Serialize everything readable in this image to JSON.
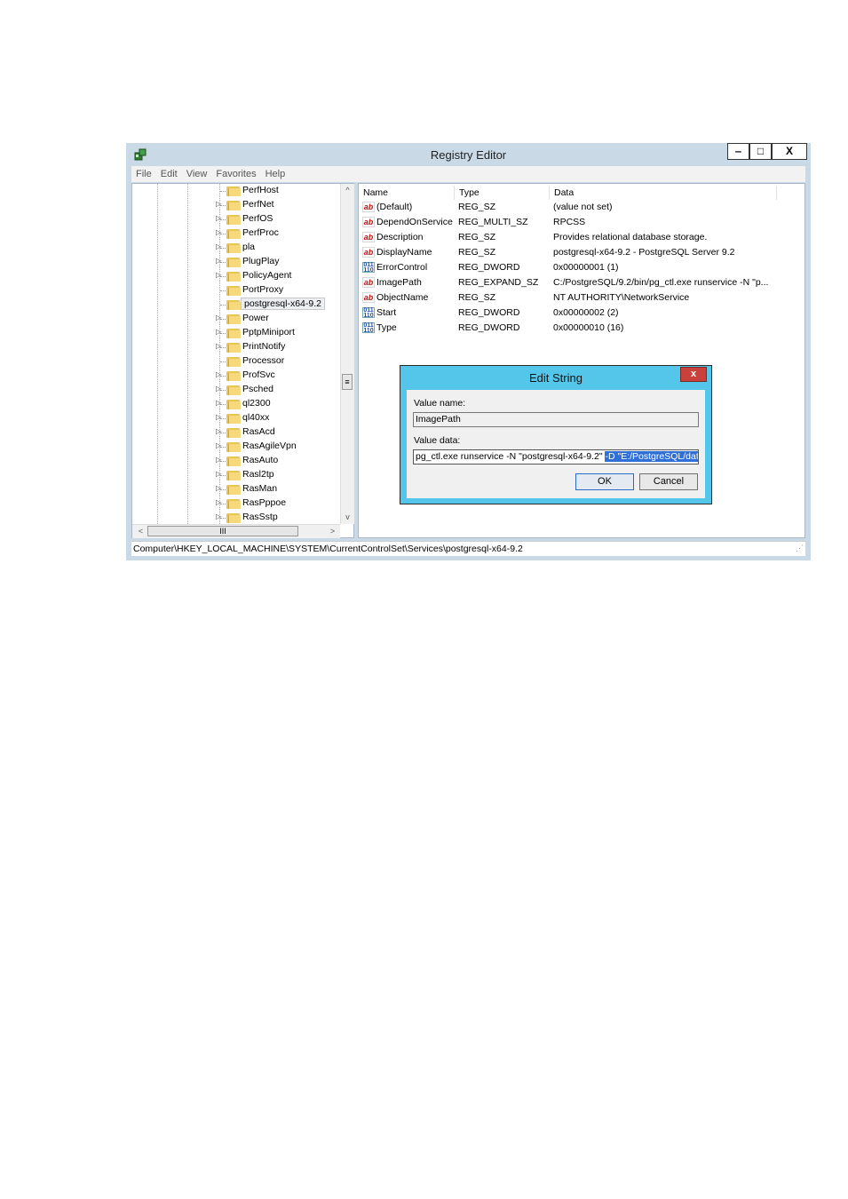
{
  "window": {
    "title": "Registry Editor",
    "controls": {
      "minimize": "‒",
      "maximize": "□",
      "close": "X"
    }
  },
  "menubar": [
    "File",
    "Edit",
    "View",
    "Favorites",
    "Help"
  ],
  "tree": {
    "items": [
      {
        "label": "PerfHost",
        "expandable": false
      },
      {
        "label": "PerfNet",
        "expandable": true
      },
      {
        "label": "PerfOS",
        "expandable": true
      },
      {
        "label": "PerfProc",
        "expandable": true
      },
      {
        "label": "pla",
        "expandable": true
      },
      {
        "label": "PlugPlay",
        "expandable": true
      },
      {
        "label": "PolicyAgent",
        "expandable": true
      },
      {
        "label": "PortProxy",
        "expandable": false
      },
      {
        "label": "postgresql-x64-9.2",
        "expandable": false,
        "selected": true
      },
      {
        "label": "Power",
        "expandable": true
      },
      {
        "label": "PptpMiniport",
        "expandable": true
      },
      {
        "label": "PrintNotify",
        "expandable": true
      },
      {
        "label": "Processor",
        "expandable": false
      },
      {
        "label": "ProfSvc",
        "expandable": true
      },
      {
        "label": "Psched",
        "expandable": true
      },
      {
        "label": "ql2300",
        "expandable": true
      },
      {
        "label": "ql40xx",
        "expandable": true
      },
      {
        "label": "RasAcd",
        "expandable": true
      },
      {
        "label": "RasAgileVpn",
        "expandable": true
      },
      {
        "label": "RasAuto",
        "expandable": true
      },
      {
        "label": "Rasl2tp",
        "expandable": true
      },
      {
        "label": "RasMan",
        "expandable": true
      },
      {
        "label": "RasPppoe",
        "expandable": true
      },
      {
        "label": "RasSstp",
        "expandable": true
      }
    ],
    "scroll_up": "^",
    "scroll_down": "v",
    "scroll_thumb": "≡",
    "scroll_left": "<",
    "scroll_right": ">",
    "hscroll_thumb": "III"
  },
  "list": {
    "columns": [
      "Name",
      "Type",
      "Data"
    ],
    "rows": [
      {
        "icon": "string-value-icon",
        "name": "(Default)",
        "type": "REG_SZ",
        "data": "(value not set)"
      },
      {
        "icon": "string-value-icon",
        "name": "DependOnService",
        "type": "REG_MULTI_SZ",
        "data": "RPCSS"
      },
      {
        "icon": "string-value-icon",
        "name": "Description",
        "type": "REG_SZ",
        "data": "Provides relational database storage."
      },
      {
        "icon": "string-value-icon",
        "name": "DisplayName",
        "type": "REG_SZ",
        "data": "postgresql-x64-9.2 - PostgreSQL Server 9.2"
      },
      {
        "icon": "dword-value-icon",
        "name": "ErrorControl",
        "type": "REG_DWORD",
        "data": "0x00000001 (1)"
      },
      {
        "icon": "string-value-icon",
        "name": "ImagePath",
        "type": "REG_EXPAND_SZ",
        "data": "C:/PostgreSQL/9.2/bin/pg_ctl.exe runservice -N \"p..."
      },
      {
        "icon": "string-value-icon",
        "name": "ObjectName",
        "type": "REG_SZ",
        "data": "NT AUTHORITY\\NetworkService"
      },
      {
        "icon": "dword-value-icon",
        "name": "Start",
        "type": "REG_DWORD",
        "data": "0x00000002 (2)"
      },
      {
        "icon": "dword-value-icon",
        "name": "Type",
        "type": "REG_DWORD",
        "data": "0x00000010 (16)"
      }
    ],
    "icon_glyphs": {
      "sz": "ab",
      "dw": "011 110"
    }
  },
  "statusbar": {
    "path": "Computer\\HKEY_LOCAL_MACHINE\\SYSTEM\\CurrentControlSet\\Services\\postgresql-x64-9.2"
  },
  "dialog": {
    "title": "Edit String",
    "close": "x",
    "value_name_label": "Value name:",
    "value_name": "ImagePath",
    "value_data_label": "Value data:",
    "value_data_plain": "pg_ctl.exe runservice -N \"postgresql-x64-9.2\" ",
    "value_data_selected": "-D \"E:/PostgreSQL/data\" -w",
    "ok_label": "OK",
    "cancel_label": "Cancel"
  }
}
